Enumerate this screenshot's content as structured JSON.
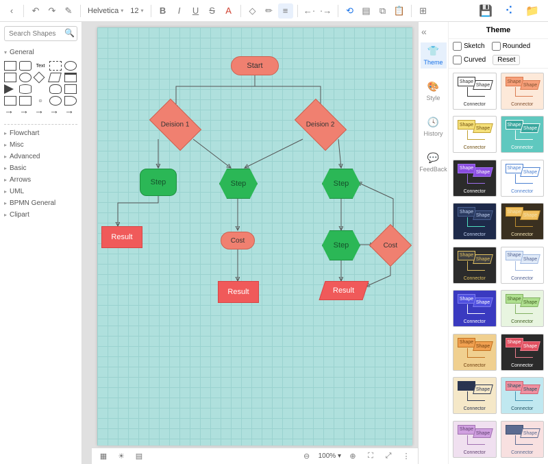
{
  "toolbar": {
    "font_family": "Helvetica",
    "font_size": "12"
  },
  "search": {
    "placeholder": "Search Shapes"
  },
  "shape_categories": {
    "general": "General",
    "others": [
      "Flowchart",
      "Misc",
      "Advanced",
      "Basic",
      "Arrows",
      "UML",
      "BPMN General",
      "Clipart"
    ]
  },
  "format_tabs": {
    "theme": "Theme",
    "style": "Style",
    "history": "History",
    "feedback": "FeedBack"
  },
  "theme_panel": {
    "title": "Theme",
    "sketch": "Sketch",
    "rounded": "Rounded",
    "curved": "Curved",
    "reset": "Reset",
    "card_shape": "Shape",
    "card_connector": "Connector"
  },
  "themes": [
    {
      "bg": "#ffffff",
      "s1bg": "#ffffff",
      "s1br": "#333333",
      "s2bg": "#ffffff",
      "s2br": "#333333",
      "ln": "#333333",
      "tx": "#333333"
    },
    {
      "bg": "#fde9d9",
      "s1bg": "#f7a07a",
      "s1br": "#d97a50",
      "s2bg": "#f7a07a",
      "s2br": "#d97a50",
      "ln": "#d97a50",
      "tx": "#805030"
    },
    {
      "bg": "#ffffff",
      "s1bg": "#f5e07a",
      "s1br": "#c0a030",
      "s2bg": "#f5e07a",
      "s2br": "#c0a030",
      "ln": "#c0a030",
      "tx": "#705010"
    },
    {
      "bg": "#5fc8bf",
      "s1bg": "#3aa79e",
      "s1br": "#ffffff",
      "s2bg": "#3aa79e",
      "s2br": "#ffffff",
      "ln": "#ffffff",
      "tx": "#ffffff"
    },
    {
      "bg": "#2b2b2b",
      "s1bg": "#8a4de0",
      "s1br": "#a070f0",
      "s2bg": "#8a4de0",
      "s2br": "#a070f0",
      "ln": "#a070f0",
      "tx": "#ffffff"
    },
    {
      "bg": "#ffffff",
      "s1bg": "#ffffff",
      "s1br": "#4a7fd0",
      "s2bg": "#ffffff",
      "s2br": "#4a7fd0",
      "ln": "#4a7fd0",
      "tx": "#4a7fd0"
    },
    {
      "bg": "#1e2a4a",
      "s1bg": "#2a3a60",
      "s1br": "#4a6090",
      "s2bg": "#2a3a60",
      "s2br": "#4a6090",
      "ln": "#50e0c0",
      "tx": "#c0d0f0"
    },
    {
      "bg": "#3a3020",
      "s1bg": "#f0c060",
      "s1br": "#c09030",
      "s2bg": "#f0c060",
      "s2br": "#c09030",
      "ln": "#c09030",
      "tx": "#f0e0b0"
    },
    {
      "bg": "#2b2b2b",
      "s1bg": "#404040",
      "s1br": "#e0c060",
      "s2bg": "#404040",
      "s2br": "#e0c060",
      "ln": "#e0c060",
      "tx": "#e0c060"
    },
    {
      "bg": "#ffffff",
      "s1bg": "#e0eaf8",
      "s1br": "#a0b8e0",
      "s2bg": "#e0eaf8",
      "s2br": "#a0b8e0",
      "ln": "#a0b8e0",
      "tx": "#506090"
    },
    {
      "bg": "#3a3ac0",
      "s1bg": "#5050e0",
      "s1br": "#8080f0",
      "s2bg": "#5050e0",
      "s2br": "#8080f0",
      "ln": "#ffffff",
      "tx": "#ffffff"
    },
    {
      "bg": "#e8f5e0",
      "s1bg": "#b0e090",
      "s1br": "#80b060",
      "s2bg": "#b0e090",
      "s2br": "#80b060",
      "ln": "#80b060",
      "tx": "#406020"
    },
    {
      "bg": "#f0d090",
      "s1bg": "#f0a050",
      "s1br": "#c07020",
      "s2bg": "#f0a050",
      "s2br": "#c07020",
      "ln": "#c07020",
      "tx": "#704010"
    },
    {
      "bg": "#2b2b2b",
      "s1bg": "#e05060",
      "s1br": "#f08090",
      "s2bg": "#e05060",
      "s2br": "#f08090",
      "ln": "#f08090",
      "tx": "#ffffff"
    },
    {
      "bg": "#f5e8c8",
      "s1bg": "#2a3550",
      "s1br": "#2a3550",
      "s2bg": "#f5e8c8",
      "s2br": "#2a3550",
      "ln": "#2a3550",
      "tx": "#2a3550"
    },
    {
      "bg": "#c0e8f0",
      "s1bg": "#f090a0",
      "s1br": "#d06070",
      "s2bg": "#f090a0",
      "s2br": "#d06070",
      "ln": "#4090b0",
      "tx": "#205060"
    },
    {
      "bg": "#f0e0f0",
      "s1bg": "#d0a0e0",
      "s1br": "#a070b0",
      "s2bg": "#d0a0e0",
      "s2br": "#a070b0",
      "ln": "#a070b0",
      "tx": "#604070"
    },
    {
      "bg": "#f8e0e0",
      "s1bg": "#5a6a90",
      "s1br": "#405070",
      "s2bg": "#f8e0e0",
      "s2br": "#5a6a90",
      "ln": "#5a6a90",
      "tx": "#5a6a90"
    }
  ],
  "flowchart": {
    "start": "Start",
    "decision1": "Deision 1",
    "decision2": "Deision 2",
    "step": "Step",
    "result": "Result",
    "cost": "Cost"
  },
  "zoom": {
    "level": "100%"
  }
}
